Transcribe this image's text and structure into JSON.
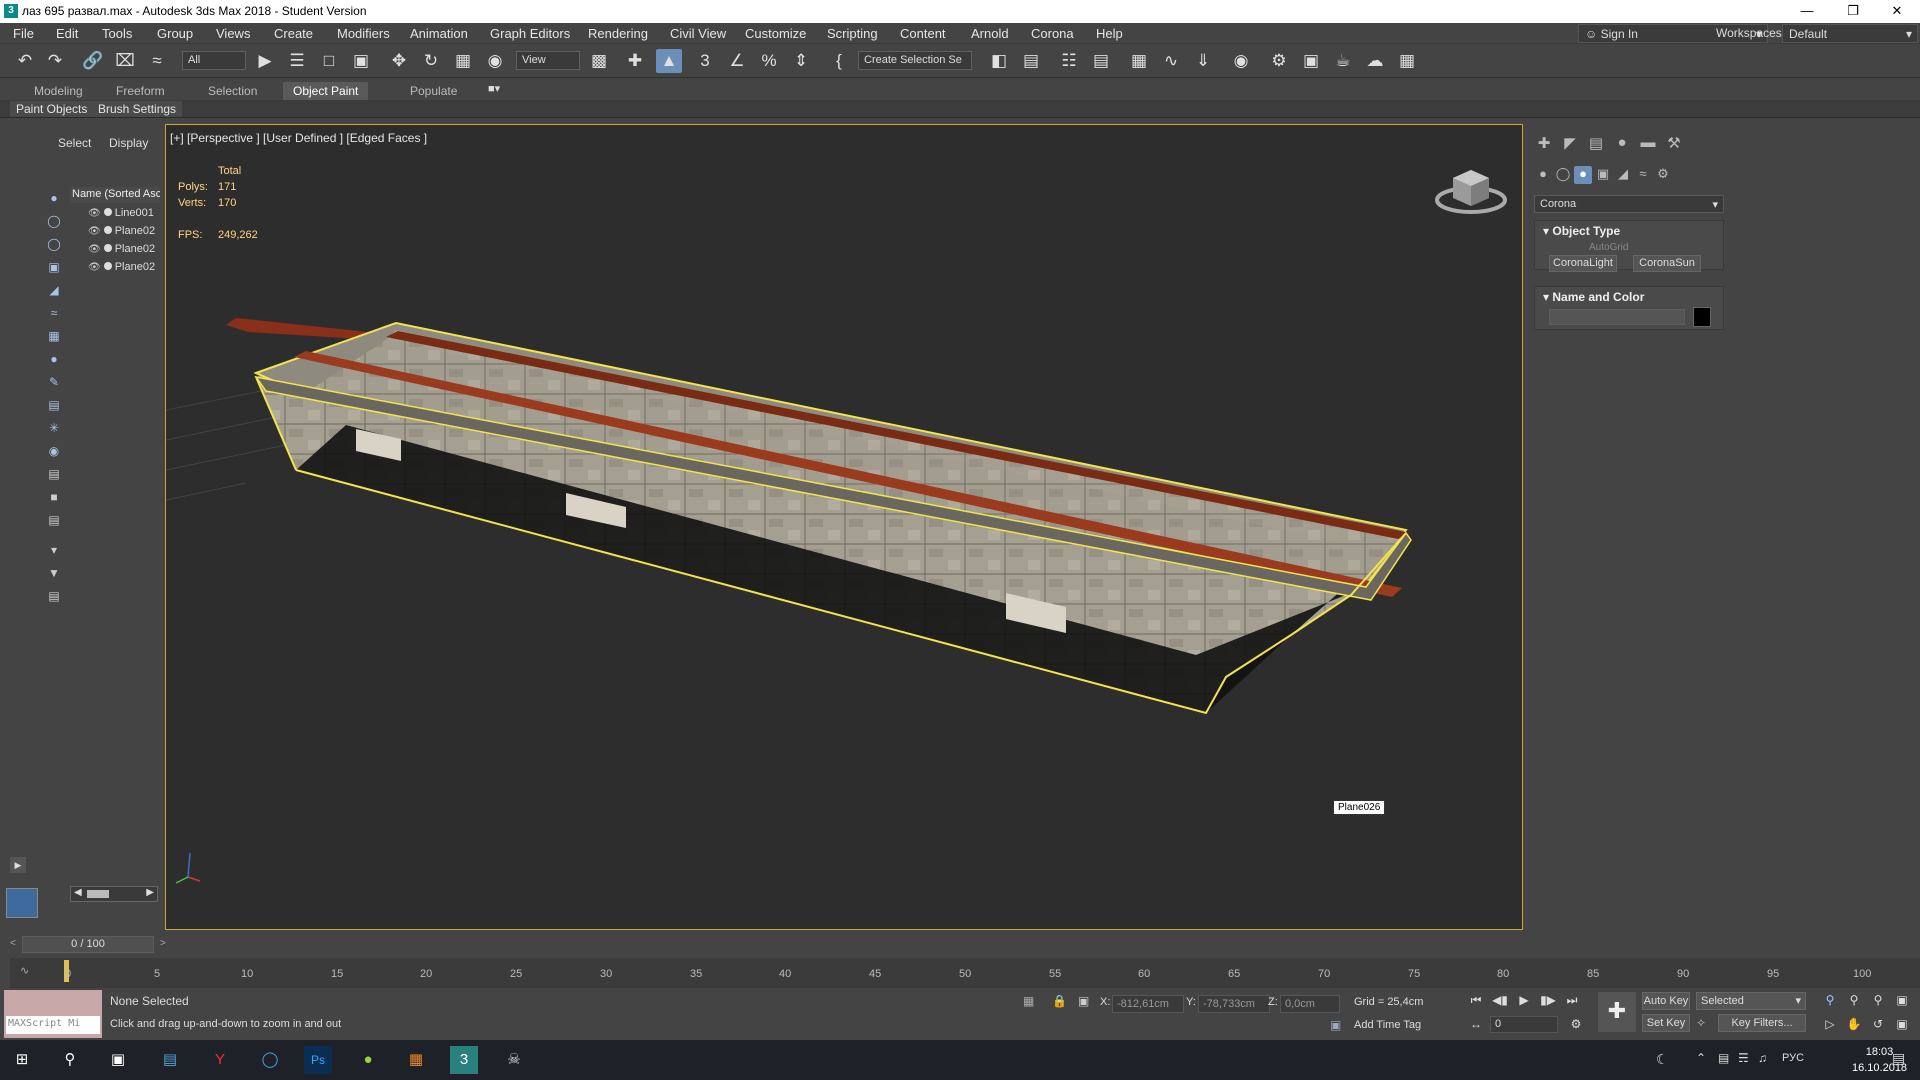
{
  "window": {
    "title": "лаз 695 развал.max - Autodesk 3ds Max 2018 - Student Version",
    "app_icon": "3",
    "minimize": "—",
    "maximize": "❐",
    "close": "✕"
  },
  "menu": [
    "File",
    "Edit",
    "Tools",
    "Group",
    "Views",
    "Create",
    "Modifiers",
    "Animation",
    "Graph Editors",
    "Rendering",
    "Civil View",
    "Customize",
    "Scripting",
    "Content",
    "Arnold",
    "Corona",
    "Help"
  ],
  "signin": {
    "label": "Sign In"
  },
  "workspaces": {
    "label": "Workspaces:",
    "value": "Default"
  },
  "toolbar": {
    "filter_value": "All",
    "refcoord_value": "View",
    "selection_set_value": "Create Selection Se"
  },
  "ribbon": {
    "tabs": [
      "Modeling",
      "Freeform",
      "Selection",
      "Object Paint",
      "Populate"
    ],
    "active_tab": "Object Paint",
    "panels": [
      "Paint Objects",
      "Brush Settings"
    ]
  },
  "explorer": {
    "tab_select": "Select",
    "tab_display": "Display",
    "header": "Name (Sorted Asc",
    "rows": [
      "Line001",
      "Plane02",
      "Plane02",
      "Plane02"
    ]
  },
  "viewport": {
    "label": "[+] [Perspective ] [User Defined ] [Edged Faces ]",
    "stats": {
      "total_label": "Total",
      "polys_label": "Polys:",
      "polys": "171",
      "verts_label": "Verts:",
      "verts": "170",
      "fps_label": "FPS:",
      "fps": "249,262"
    },
    "tooltip": "Plane026"
  },
  "command_panel": {
    "renderer": "Corona",
    "object_type_title": "Object Type",
    "autogrid": "AutoGrid",
    "btn_light": "CoronaLight",
    "btn_sun": "CoronaSun",
    "name_color_title": "Name and Color"
  },
  "timeline": {
    "frame": "0 / 100",
    "ticks": [
      "0",
      "5",
      "10",
      "15",
      "20",
      "25",
      "30",
      "35",
      "40",
      "45",
      "50",
      "55",
      "60",
      "65",
      "70",
      "75",
      "80",
      "85",
      "90",
      "95",
      "100"
    ]
  },
  "status": {
    "maxscript_placeholder": "MAXScript Mi",
    "selection": "None Selected",
    "prompt": "Click and drag up-and-down to zoom in and out",
    "x_label": "X:",
    "x_value": "-812,61cm",
    "y_label": "Y:",
    "y_value": "-78,733cm",
    "z_label": "Z:",
    "z_value": "0,0cm",
    "grid": "Grid = 25,4cm",
    "add_time_tag": "Add Time Tag",
    "auto_key": "Auto Key",
    "set_key": "Set Key",
    "selected_dropdown": "Selected",
    "key_filters": "Key Filters...",
    "frame_spinner": "0"
  },
  "taskbar": {
    "time": "18:03",
    "date": "16.10.2018",
    "lang": "РУС"
  }
}
